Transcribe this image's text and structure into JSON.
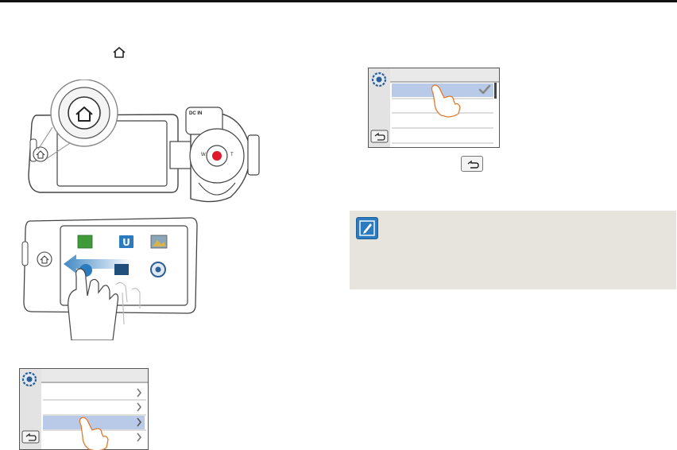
{
  "page": {
    "section": "settings-menu-instructions"
  },
  "camera": {
    "jack_label": "DC IN",
    "zoom_wide": "W",
    "zoom_tele": "T"
  },
  "icons": {
    "home": "home-icon",
    "back": "back-arrow-icon",
    "settings": "gear-icon",
    "check": "checkmark-icon",
    "chevron": "chevron-right-icon",
    "note": "pencil-note-icon"
  },
  "colors": {
    "menu_highlight": "#b9c9e8",
    "record_button": "#e0192a",
    "note_background": "#e6e4dc",
    "note_icon": "#2c7bbf",
    "top_rule": "#111111"
  }
}
